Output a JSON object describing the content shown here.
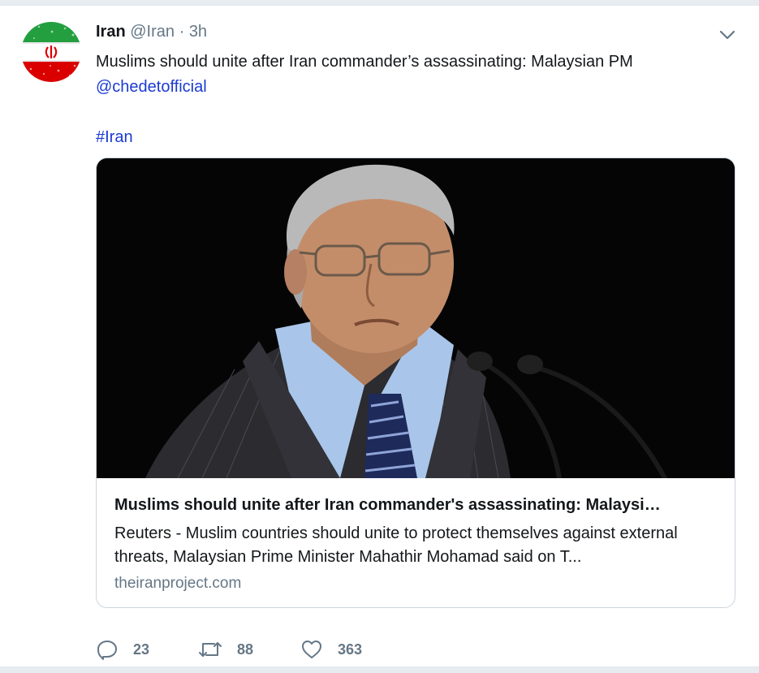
{
  "tweet": {
    "display_name": "Iran",
    "handle": "@Iran",
    "separator": "·",
    "time": "3h",
    "text_line1": "Muslims should unite after Iran commander’s assassinating: Malaysian PM",
    "mention": "@chedetofficial",
    "hashtag": "#Iran"
  },
  "card": {
    "title": "Muslims should unite after Iran commander's assassinating: Malaysi…",
    "description": "Reuters - Muslim countries should unite to protect themselves against external threats, Malaysian Prime Minister Mahathir Mohamad said on T...",
    "domain": "theiranproject.com"
  },
  "actions": {
    "replies": "23",
    "retweets": "88",
    "likes": "363"
  },
  "icons": {
    "avatar": "iran-flag-avatar",
    "menu": "chevron-down-icon",
    "reply": "reply-icon",
    "retweet": "retweet-icon",
    "like": "heart-icon"
  },
  "colors": {
    "link": "#1b3bd1",
    "muted": "#657786",
    "border": "#ccd6dd",
    "background": "#e6ecf0"
  }
}
